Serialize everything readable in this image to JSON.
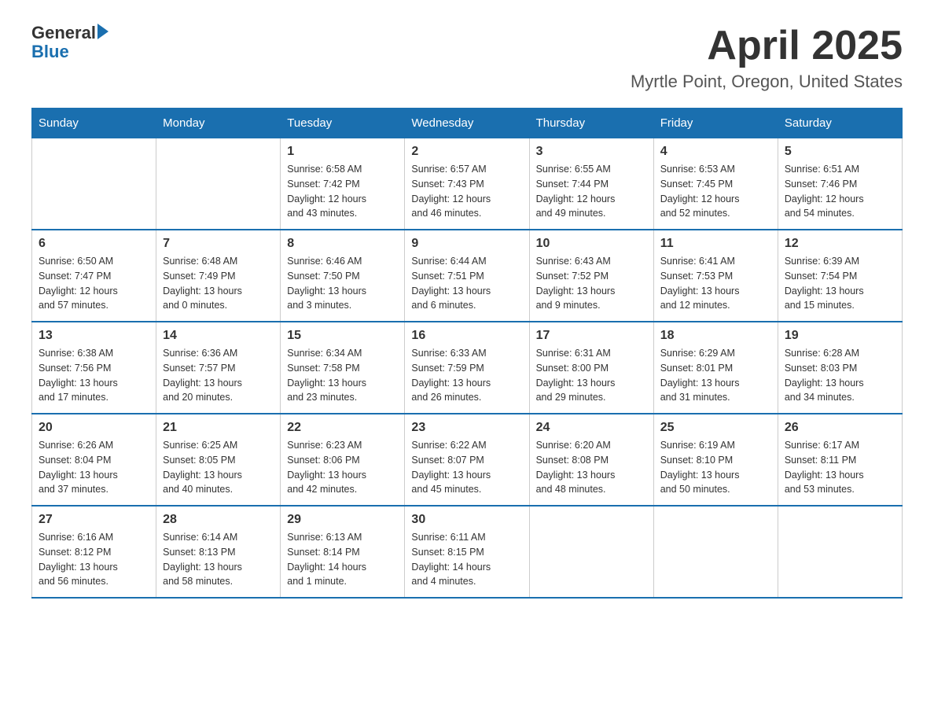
{
  "header": {
    "logo_line1": "General",
    "logo_line2": "Blue",
    "title": "April 2025",
    "subtitle": "Myrtle Point, Oregon, United States"
  },
  "weekdays": [
    "Sunday",
    "Monday",
    "Tuesday",
    "Wednesday",
    "Thursday",
    "Friday",
    "Saturday"
  ],
  "weeks": [
    [
      {
        "day": "",
        "info": ""
      },
      {
        "day": "",
        "info": ""
      },
      {
        "day": "1",
        "info": "Sunrise: 6:58 AM\nSunset: 7:42 PM\nDaylight: 12 hours\nand 43 minutes."
      },
      {
        "day": "2",
        "info": "Sunrise: 6:57 AM\nSunset: 7:43 PM\nDaylight: 12 hours\nand 46 minutes."
      },
      {
        "day": "3",
        "info": "Sunrise: 6:55 AM\nSunset: 7:44 PM\nDaylight: 12 hours\nand 49 minutes."
      },
      {
        "day": "4",
        "info": "Sunrise: 6:53 AM\nSunset: 7:45 PM\nDaylight: 12 hours\nand 52 minutes."
      },
      {
        "day": "5",
        "info": "Sunrise: 6:51 AM\nSunset: 7:46 PM\nDaylight: 12 hours\nand 54 minutes."
      }
    ],
    [
      {
        "day": "6",
        "info": "Sunrise: 6:50 AM\nSunset: 7:47 PM\nDaylight: 12 hours\nand 57 minutes."
      },
      {
        "day": "7",
        "info": "Sunrise: 6:48 AM\nSunset: 7:49 PM\nDaylight: 13 hours\nand 0 minutes."
      },
      {
        "day": "8",
        "info": "Sunrise: 6:46 AM\nSunset: 7:50 PM\nDaylight: 13 hours\nand 3 minutes."
      },
      {
        "day": "9",
        "info": "Sunrise: 6:44 AM\nSunset: 7:51 PM\nDaylight: 13 hours\nand 6 minutes."
      },
      {
        "day": "10",
        "info": "Sunrise: 6:43 AM\nSunset: 7:52 PM\nDaylight: 13 hours\nand 9 minutes."
      },
      {
        "day": "11",
        "info": "Sunrise: 6:41 AM\nSunset: 7:53 PM\nDaylight: 13 hours\nand 12 minutes."
      },
      {
        "day": "12",
        "info": "Sunrise: 6:39 AM\nSunset: 7:54 PM\nDaylight: 13 hours\nand 15 minutes."
      }
    ],
    [
      {
        "day": "13",
        "info": "Sunrise: 6:38 AM\nSunset: 7:56 PM\nDaylight: 13 hours\nand 17 minutes."
      },
      {
        "day": "14",
        "info": "Sunrise: 6:36 AM\nSunset: 7:57 PM\nDaylight: 13 hours\nand 20 minutes."
      },
      {
        "day": "15",
        "info": "Sunrise: 6:34 AM\nSunset: 7:58 PM\nDaylight: 13 hours\nand 23 minutes."
      },
      {
        "day": "16",
        "info": "Sunrise: 6:33 AM\nSunset: 7:59 PM\nDaylight: 13 hours\nand 26 minutes."
      },
      {
        "day": "17",
        "info": "Sunrise: 6:31 AM\nSunset: 8:00 PM\nDaylight: 13 hours\nand 29 minutes."
      },
      {
        "day": "18",
        "info": "Sunrise: 6:29 AM\nSunset: 8:01 PM\nDaylight: 13 hours\nand 31 minutes."
      },
      {
        "day": "19",
        "info": "Sunrise: 6:28 AM\nSunset: 8:03 PM\nDaylight: 13 hours\nand 34 minutes."
      }
    ],
    [
      {
        "day": "20",
        "info": "Sunrise: 6:26 AM\nSunset: 8:04 PM\nDaylight: 13 hours\nand 37 minutes."
      },
      {
        "day": "21",
        "info": "Sunrise: 6:25 AM\nSunset: 8:05 PM\nDaylight: 13 hours\nand 40 minutes."
      },
      {
        "day": "22",
        "info": "Sunrise: 6:23 AM\nSunset: 8:06 PM\nDaylight: 13 hours\nand 42 minutes."
      },
      {
        "day": "23",
        "info": "Sunrise: 6:22 AM\nSunset: 8:07 PM\nDaylight: 13 hours\nand 45 minutes."
      },
      {
        "day": "24",
        "info": "Sunrise: 6:20 AM\nSunset: 8:08 PM\nDaylight: 13 hours\nand 48 minutes."
      },
      {
        "day": "25",
        "info": "Sunrise: 6:19 AM\nSunset: 8:10 PM\nDaylight: 13 hours\nand 50 minutes."
      },
      {
        "day": "26",
        "info": "Sunrise: 6:17 AM\nSunset: 8:11 PM\nDaylight: 13 hours\nand 53 minutes."
      }
    ],
    [
      {
        "day": "27",
        "info": "Sunrise: 6:16 AM\nSunset: 8:12 PM\nDaylight: 13 hours\nand 56 minutes."
      },
      {
        "day": "28",
        "info": "Sunrise: 6:14 AM\nSunset: 8:13 PM\nDaylight: 13 hours\nand 58 minutes."
      },
      {
        "day": "29",
        "info": "Sunrise: 6:13 AM\nSunset: 8:14 PM\nDaylight: 14 hours\nand 1 minute."
      },
      {
        "day": "30",
        "info": "Sunrise: 6:11 AM\nSunset: 8:15 PM\nDaylight: 14 hours\nand 4 minutes."
      },
      {
        "day": "",
        "info": ""
      },
      {
        "day": "",
        "info": ""
      },
      {
        "day": "",
        "info": ""
      }
    ]
  ]
}
